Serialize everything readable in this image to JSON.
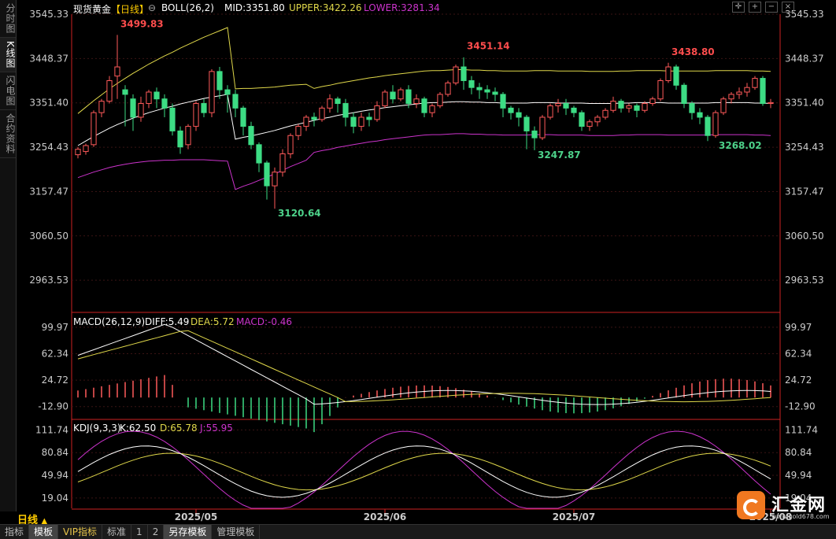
{
  "side_tabs": [
    {
      "label": "分时图",
      "active": false
    },
    {
      "label": "K线图",
      "active": true
    },
    {
      "label": "闪电图",
      "active": false
    },
    {
      "label": "合约资料",
      "active": false
    }
  ],
  "header": {
    "symbol": "现货黄金",
    "period_tag": "【日线】",
    "indicator": "BOLL(26,2)",
    "mid": "MID:3351.80",
    "upper": "UPPER:3422.26",
    "lower": "LOWER:3281.34"
  },
  "toolbar_icons": [
    "crosshair-icon",
    "zoom-in-icon",
    "zoom-out-icon",
    "close-icon"
  ],
  "price_axis": [
    "3545.33",
    "3448.37",
    "3351.40",
    "3254.43",
    "3157.47",
    "3060.50",
    "2963.53"
  ],
  "annotations": [
    {
      "text": "3499.83",
      "color": "#ff4d4d"
    },
    {
      "text": "3451.14",
      "color": "#ff4d4d"
    },
    {
      "text": "3438.80",
      "color": "#ff4d4d"
    },
    {
      "text": "3247.87",
      "color": "#4dd28a"
    },
    {
      "text": "3268.02",
      "color": "#4dd28a"
    },
    {
      "text": "3120.64",
      "color": "#4dd28a"
    }
  ],
  "macd": {
    "title": "MACD(26,12,9)",
    "diff": "DIFF:5.49",
    "dea": "DEA:5.72",
    "macd": "MACD:-0.46",
    "axis": [
      "99.97",
      "62.34",
      "24.72",
      "-12.90"
    ]
  },
  "kdj": {
    "title": "KDJ(9,3,3)",
    "k": "K:62.50",
    "d": "D:65.78",
    "j": "J:55.95",
    "axis": [
      "111.74",
      "80.84",
      "49.94",
      "19.04"
    ]
  },
  "dates": [
    "2025/05",
    "2025/06",
    "2025/07",
    "2025/08"
  ],
  "period_label": "日线",
  "bottom_tabs": [
    "指标",
    "模板",
    "VIP指标",
    "标准",
    "1",
    "2",
    "另存模板",
    "管理模板"
  ],
  "logo": {
    "text": "汇金网",
    "url": "www.gold678.com"
  },
  "colors": {
    "up": "#ff5a5a",
    "down": "#3ddc84",
    "mid": "#ffffff",
    "upper": "#e0d84a",
    "lower": "#cc33cc",
    "grid": "#3a1414",
    "axis": "#cc2222"
  },
  "chart_data": {
    "type": "candlestick",
    "boll_mid": [
      3258,
      3268,
      3278,
      3287,
      3296,
      3304,
      3311,
      3318,
      3324,
      3330,
      3335,
      3340,
      3344,
      3349,
      3353,
      3357,
      3361,
      3364,
      3367,
      3370,
      3272,
      3276,
      3279,
      3283,
      3287,
      3291,
      3296,
      3301,
      3305,
      3309,
      3313,
      3317,
      3320,
      3324,
      3327,
      3330,
      3333,
      3336,
      3338,
      3341,
      3343,
      3345,
      3347,
      3349,
      3351,
      3352,
      3352,
      3353,
      3354,
      3354,
      3353,
      3353,
      3352,
      3352,
      3351,
      3351,
      3351,
      3351,
      3352,
      3352,
      3352,
      3351,
      3351,
      3351,
      3351,
      3350,
      3350,
      3350,
      3350,
      3351,
      3351,
      3352,
      3352,
      3352,
      3352,
      3351,
      3351,
      3351,
      3351,
      3351,
      3351,
      3352,
      3352,
      3352,
      3352,
      3352,
      3351,
      3351
    ],
    "candles": [
      [
        3238,
        3250,
        3230,
        3255
      ],
      [
        3245,
        3258,
        3238,
        3262
      ],
      [
        3260,
        3330,
        3255,
        3335
      ],
      [
        3330,
        3355,
        3320,
        3360
      ],
      [
        3355,
        3400,
        3350,
        3410
      ],
      [
        3410,
        3430,
        3360,
        3500
      ],
      [
        3380,
        3370,
        3300,
        3390
      ],
      [
        3360,
        3320,
        3290,
        3370
      ],
      [
        3320,
        3350,
        3310,
        3365
      ],
      [
        3350,
        3375,
        3340,
        3380
      ],
      [
        3375,
        3360,
        3340,
        3385
      ],
      [
        3360,
        3340,
        3320,
        3370
      ],
      [
        3340,
        3290,
        3280,
        3350
      ],
      [
        3290,
        3255,
        3240,
        3300
      ],
      [
        3260,
        3300,
        3250,
        3305
      ],
      [
        3300,
        3350,
        3290,
        3355
      ],
      [
        3350,
        3330,
        3320,
        3360
      ],
      [
        3330,
        3420,
        3320,
        3425
      ],
      [
        3420,
        3380,
        3360,
        3430
      ],
      [
        3380,
        3370,
        3330,
        3390
      ],
      [
        3370,
        3340,
        3320,
        3380
      ],
      [
        3340,
        3300,
        3280,
        3345
      ],
      [
        3300,
        3260,
        3250,
        3310
      ],
      [
        3260,
        3220,
        3200,
        3265
      ],
      [
        3220,
        3170,
        3140,
        3225
      ],
      [
        3170,
        3200,
        3120,
        3210
      ],
      [
        3200,
        3240,
        3190,
        3250
      ],
      [
        3240,
        3280,
        3230,
        3285
      ],
      [
        3280,
        3300,
        3270,
        3305
      ],
      [
        3300,
        3320,
        3290,
        3325
      ],
      [
        3320,
        3315,
        3300,
        3330
      ],
      [
        3315,
        3340,
        3310,
        3345
      ],
      [
        3340,
        3360,
        3330,
        3370
      ],
      [
        3360,
        3350,
        3330,
        3365
      ],
      [
        3350,
        3320,
        3300,
        3360
      ],
      [
        3320,
        3300,
        3285,
        3330
      ],
      [
        3300,
        3320,
        3290,
        3330
      ],
      [
        3320,
        3315,
        3300,
        3330
      ],
      [
        3315,
        3345,
        3310,
        3355
      ],
      [
        3345,
        3375,
        3340,
        3380
      ],
      [
        3375,
        3360,
        3350,
        3390
      ],
      [
        3360,
        3380,
        3355,
        3385
      ],
      [
        3380,
        3350,
        3340,
        3390
      ],
      [
        3350,
        3360,
        3340,
        3370
      ],
      [
        3360,
        3330,
        3320,
        3365
      ],
      [
        3330,
        3345,
        3320,
        3350
      ],
      [
        3345,
        3370,
        3340,
        3375
      ],
      [
        3370,
        3395,
        3365,
        3400
      ],
      [
        3395,
        3430,
        3390,
        3435
      ],
      [
        3430,
        3400,
        3380,
        3451
      ],
      [
        3400,
        3385,
        3370,
        3410
      ],
      [
        3385,
        3380,
        3360,
        3395
      ],
      [
        3380,
        3375,
        3360,
        3390
      ],
      [
        3375,
        3370,
        3355,
        3385
      ],
      [
        3370,
        3340,
        3320,
        3375
      ],
      [
        3340,
        3330,
        3315,
        3345
      ],
      [
        3330,
        3320,
        3300,
        3340
      ],
      [
        3320,
        3290,
        3250,
        3325
      ],
      [
        3290,
        3275,
        3248,
        3300
      ],
      [
        3275,
        3320,
        3270,
        3325
      ],
      [
        3320,
        3345,
        3315,
        3350
      ],
      [
        3345,
        3350,
        3330,
        3360
      ],
      [
        3350,
        3340,
        3325,
        3360
      ],
      [
        3340,
        3330,
        3320,
        3345
      ],
      [
        3330,
        3300,
        3290,
        3335
      ],
      [
        3300,
        3310,
        3290,
        3315
      ],
      [
        3310,
        3320,
        3300,
        3325
      ],
      [
        3320,
        3335,
        3315,
        3340
      ],
      [
        3335,
        3355,
        3330,
        3365
      ],
      [
        3355,
        3340,
        3330,
        3360
      ],
      [
        3340,
        3345,
        3330,
        3350
      ],
      [
        3345,
        3335,
        3320,
        3350
      ],
      [
        3335,
        3350,
        3330,
        3355
      ],
      [
        3350,
        3360,
        3345,
        3365
      ],
      [
        3360,
        3400,
        3355,
        3405
      ],
      [
        3400,
        3430,
        3395,
        3439
      ],
      [
        3430,
        3390,
        3380,
        3435
      ],
      [
        3390,
        3350,
        3340,
        3395
      ],
      [
        3350,
        3330,
        3315,
        3355
      ],
      [
        3330,
        3320,
        3305,
        3340
      ],
      [
        3320,
        3280,
        3268,
        3325
      ],
      [
        3280,
        3330,
        3275,
        3335
      ],
      [
        3330,
        3360,
        3325,
        3365
      ],
      [
        3360,
        3370,
        3350,
        3375
      ],
      [
        3370,
        3375,
        3360,
        3385
      ],
      [
        3375,
        3385,
        3365,
        3395
      ],
      [
        3385,
        3405,
        3380,
        3410
      ],
      [
        3405,
        3350,
        3345,
        3410
      ],
      [
        3350,
        3352,
        3340,
        3360
      ]
    ]
  }
}
